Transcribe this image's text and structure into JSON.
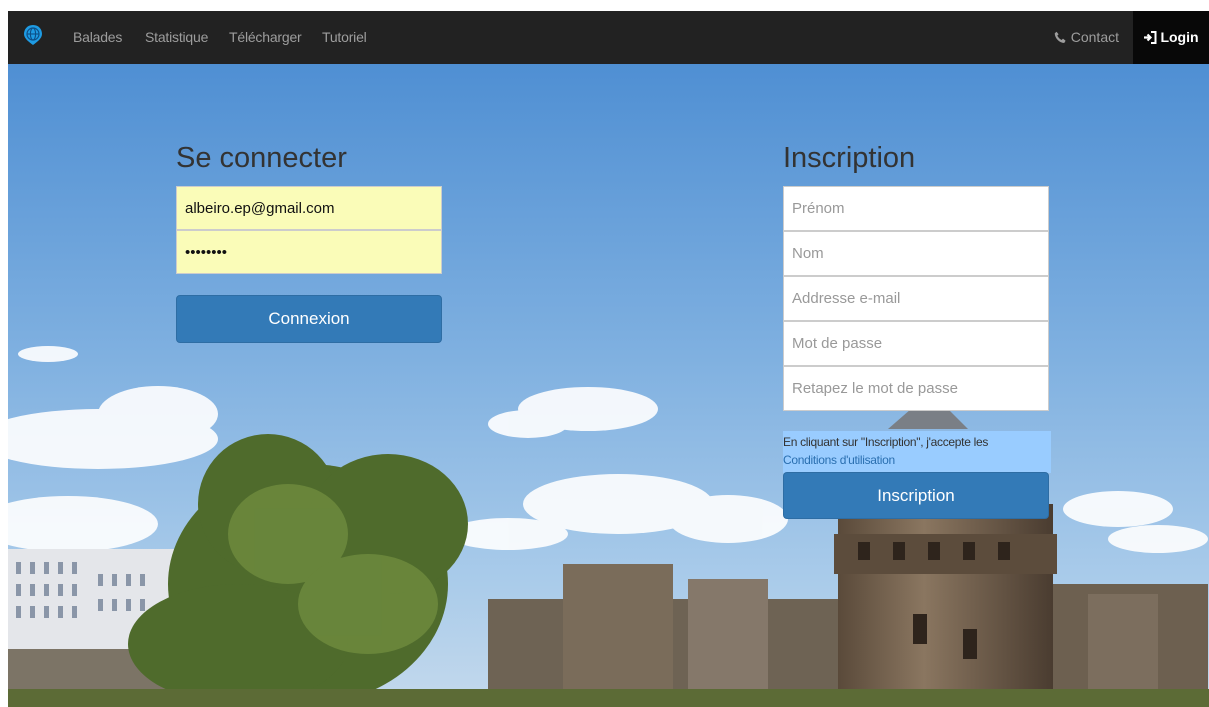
{
  "navbar": {
    "brand_icon": "globe-pin-icon",
    "links": [
      "Balades",
      "Statistique",
      "Télécharger",
      "Tutoriel"
    ],
    "contact_label": "Contact",
    "contact_icon": "phone-icon",
    "login_label": "Login",
    "login_icon": "login-arrow-icon"
  },
  "login": {
    "title": "Se connecter",
    "email_value": "albeiro.ep@gmail.com",
    "password_value": "password",
    "submit_label": "Connexion"
  },
  "signup": {
    "title": "Inscription",
    "firstname_placeholder": "Prénom",
    "lastname_placeholder": "Nom",
    "email_placeholder": "Addresse e-mail",
    "password_placeholder": "Mot de passe",
    "password_confirm_placeholder": "Retapez le mot de passe",
    "terms_text": "En cliquant sur \"Inscription\", j'accepte les",
    "terms_link": "Conditions d'utilisation",
    "submit_label": "Inscription"
  },
  "colors": {
    "navbar_bg": "#222222",
    "login_bg": "#080808",
    "primary": "#337ab7",
    "autofill": "#fafcb8",
    "terms_bg": "#99ccff"
  }
}
